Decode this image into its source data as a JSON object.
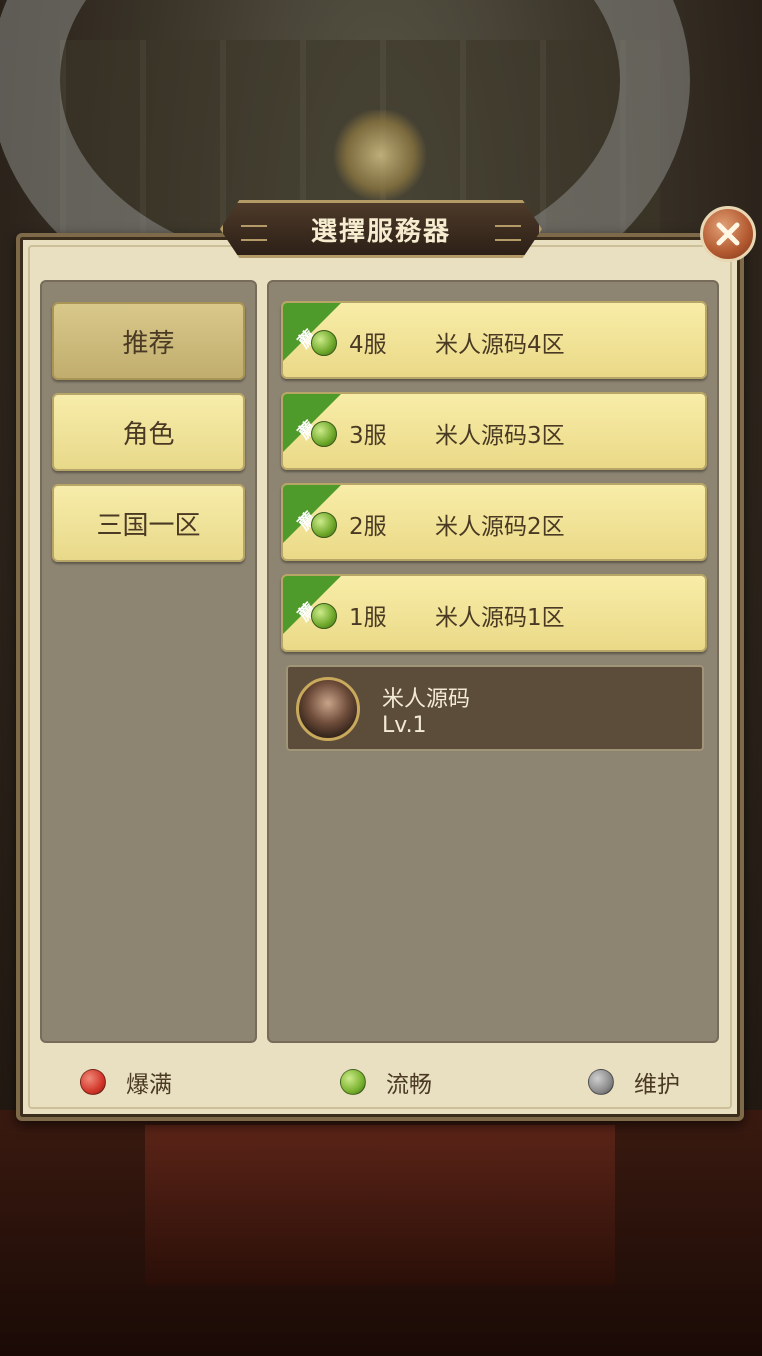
{
  "title": "選擇服務器",
  "categories": [
    {
      "label": "推荐",
      "active": true
    },
    {
      "label": "角色",
      "active": false
    },
    {
      "label": "三国一区",
      "active": false
    }
  ],
  "servers": [
    {
      "tag": "薦",
      "number": "4服",
      "name": "米人源码4区",
      "status": "流畅"
    },
    {
      "tag": "薦",
      "number": "3服",
      "name": "米人源码3区",
      "status": "流畅"
    },
    {
      "tag": "薦",
      "number": "2服",
      "name": "米人源码2区",
      "status": "流畅"
    },
    {
      "tag": "薦",
      "number": "1服",
      "name": "米人源码1区",
      "status": "流畅"
    }
  ],
  "role": {
    "name": "米人源码",
    "level": "Lv.1"
  },
  "legend": [
    {
      "label": "爆满",
      "color": "#d2372a"
    },
    {
      "label": "流畅",
      "color": "#79b22f"
    },
    {
      "label": "维护",
      "color": "#8b8b8b"
    }
  ],
  "icons": {
    "close": "close-icon",
    "status": "status-dot-icon",
    "avatar": "avatar-icon"
  }
}
